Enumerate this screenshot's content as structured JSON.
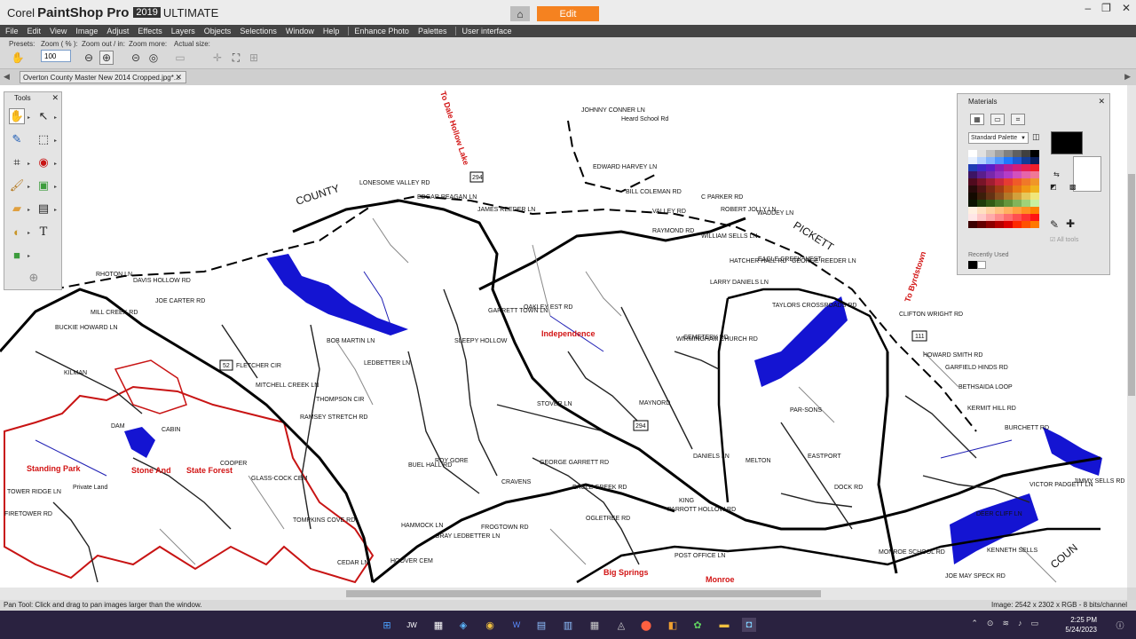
{
  "app": {
    "brand_prefix": "Corel",
    "brand_name": "PaintShop Pro",
    "brand_year": "2019",
    "brand_edition": "ULTIMATE",
    "workspace_tab": "Edit"
  },
  "menu": [
    "File",
    "Edit",
    "View",
    "Image",
    "Adjust",
    "Effects",
    "Layers",
    "Objects",
    "Selections",
    "Window",
    "Help",
    "Enhance Photo",
    "Palettes",
    "User interface"
  ],
  "options": {
    "presets_label": "Presets:",
    "zoom_label": "Zoom ( % ):",
    "zoom_value": "100",
    "zoom_out_label": "Zoom out / in:",
    "zoom_more_label": "Zoom more:",
    "actual_size_label": "Actual size:"
  },
  "document": {
    "tab_title": "Overton County Master New 2014 Cropped.jpg*..."
  },
  "tools": {
    "title": "Tools"
  },
  "materials": {
    "title": "Materials",
    "palette": "Standard Palette",
    "all_tools": "All tools",
    "recently_used": "Recently Used",
    "colors": {
      "foreground": "#000000",
      "background": "#ffffff"
    }
  },
  "status": {
    "left": "Pan Tool: Click and drag to pan images larger than the window.",
    "right": "Image:  2542 x 2302 x RGB - 8 bits/channel"
  },
  "taskbar": {
    "time": "2:25 PM",
    "date": "5/24/2023"
  },
  "map": {
    "big_labels": [
      "COUNTY",
      "PICKETT",
      "COUN"
    ],
    "red_labels": [
      "To Dale Hollow Lake",
      "To Byrdstown",
      "Independence",
      "Standing Park",
      "Stone And",
      "State Forest",
      "Big Springs",
      "Monroe"
    ],
    "road_labels": [
      "LONESOME VALLEY RD",
      "EDGAR REAGAN LN",
      "JAMES REEDER LN",
      "JOHNNY CONNER LN",
      "Heard School Rd",
      "EDWARD HARVEY LN",
      "BILL COLEMAN RD",
      "C PARKER RD",
      "ROBERT JOLLY LN",
      "WADDEY LN",
      "VALLEY RD",
      "RAYMOND RD",
      "WILLIAM SELLS LN",
      "HATCHER HALL RD",
      "EAGLE CREEK WEST",
      "GEORGE REEDER LN",
      "TAYLORS CROSSROADS RD",
      "LARRY DANIELS LN",
      "CEMETERY RD",
      "WIRMINGHAM CHURCH RD",
      "CLIFTON WRIGHT RD",
      "HOWARD SMITH RD",
      "GARFIELD HINDS RD",
      "BETHSAIDA LOOP",
      "KERMIT HILL RD",
      "BURCHETT RD",
      "RHOTON LN",
      "DAVIS HOLLOW RD",
      "JOE CARTER RD",
      "MILL CREEK RD",
      "BUCKIE HOWARD LN",
      "KILMAN",
      "FLETCHER CIR",
      "MITCHELL CREEK LN",
      "BOB MARTIN LN",
      "LEDBETTER LN",
      "THOMPSON CIR",
      "RAMSEY STRETCH RD",
      "OAKLEY EST RD",
      "GARRETT TOWN LN",
      "PAR-SONS",
      "EASTPORT",
      "DOCK RD",
      "JIMMY SELLS RD",
      "VICTOR PADGETT LN",
      "DEER CLIFF LN",
      "KENNETH SELLS",
      "JOE MAY SPECK RD",
      "MONROE SCHOOL RD",
      "POST OFFICE LN",
      "PARROTT HOLLOW RD",
      "CRAVENS",
      "GEORGE GARRETT RD",
      "EAGLE CREEK RD",
      "OGLETREE RD",
      "BUEL HALL RD",
      "ROY GORE",
      "HAMMOCK LN",
      "GRAY LEDBETTER LN",
      "FROGTOWN RD",
      "HOOVER CEM",
      "CEDAR LN",
      "TOMPKINS COVE RD",
      "GLASS-COCK CEM",
      "COOPER",
      "TOWER RIDGE LN",
      "FIRETOWER RD",
      "Private Land",
      "CABIN",
      "DAM",
      "MELTON",
      "KING",
      "DANIELS LN",
      "MAYNORD",
      "STOVER LN",
      "SLEEPY HOLLOW"
    ]
  }
}
